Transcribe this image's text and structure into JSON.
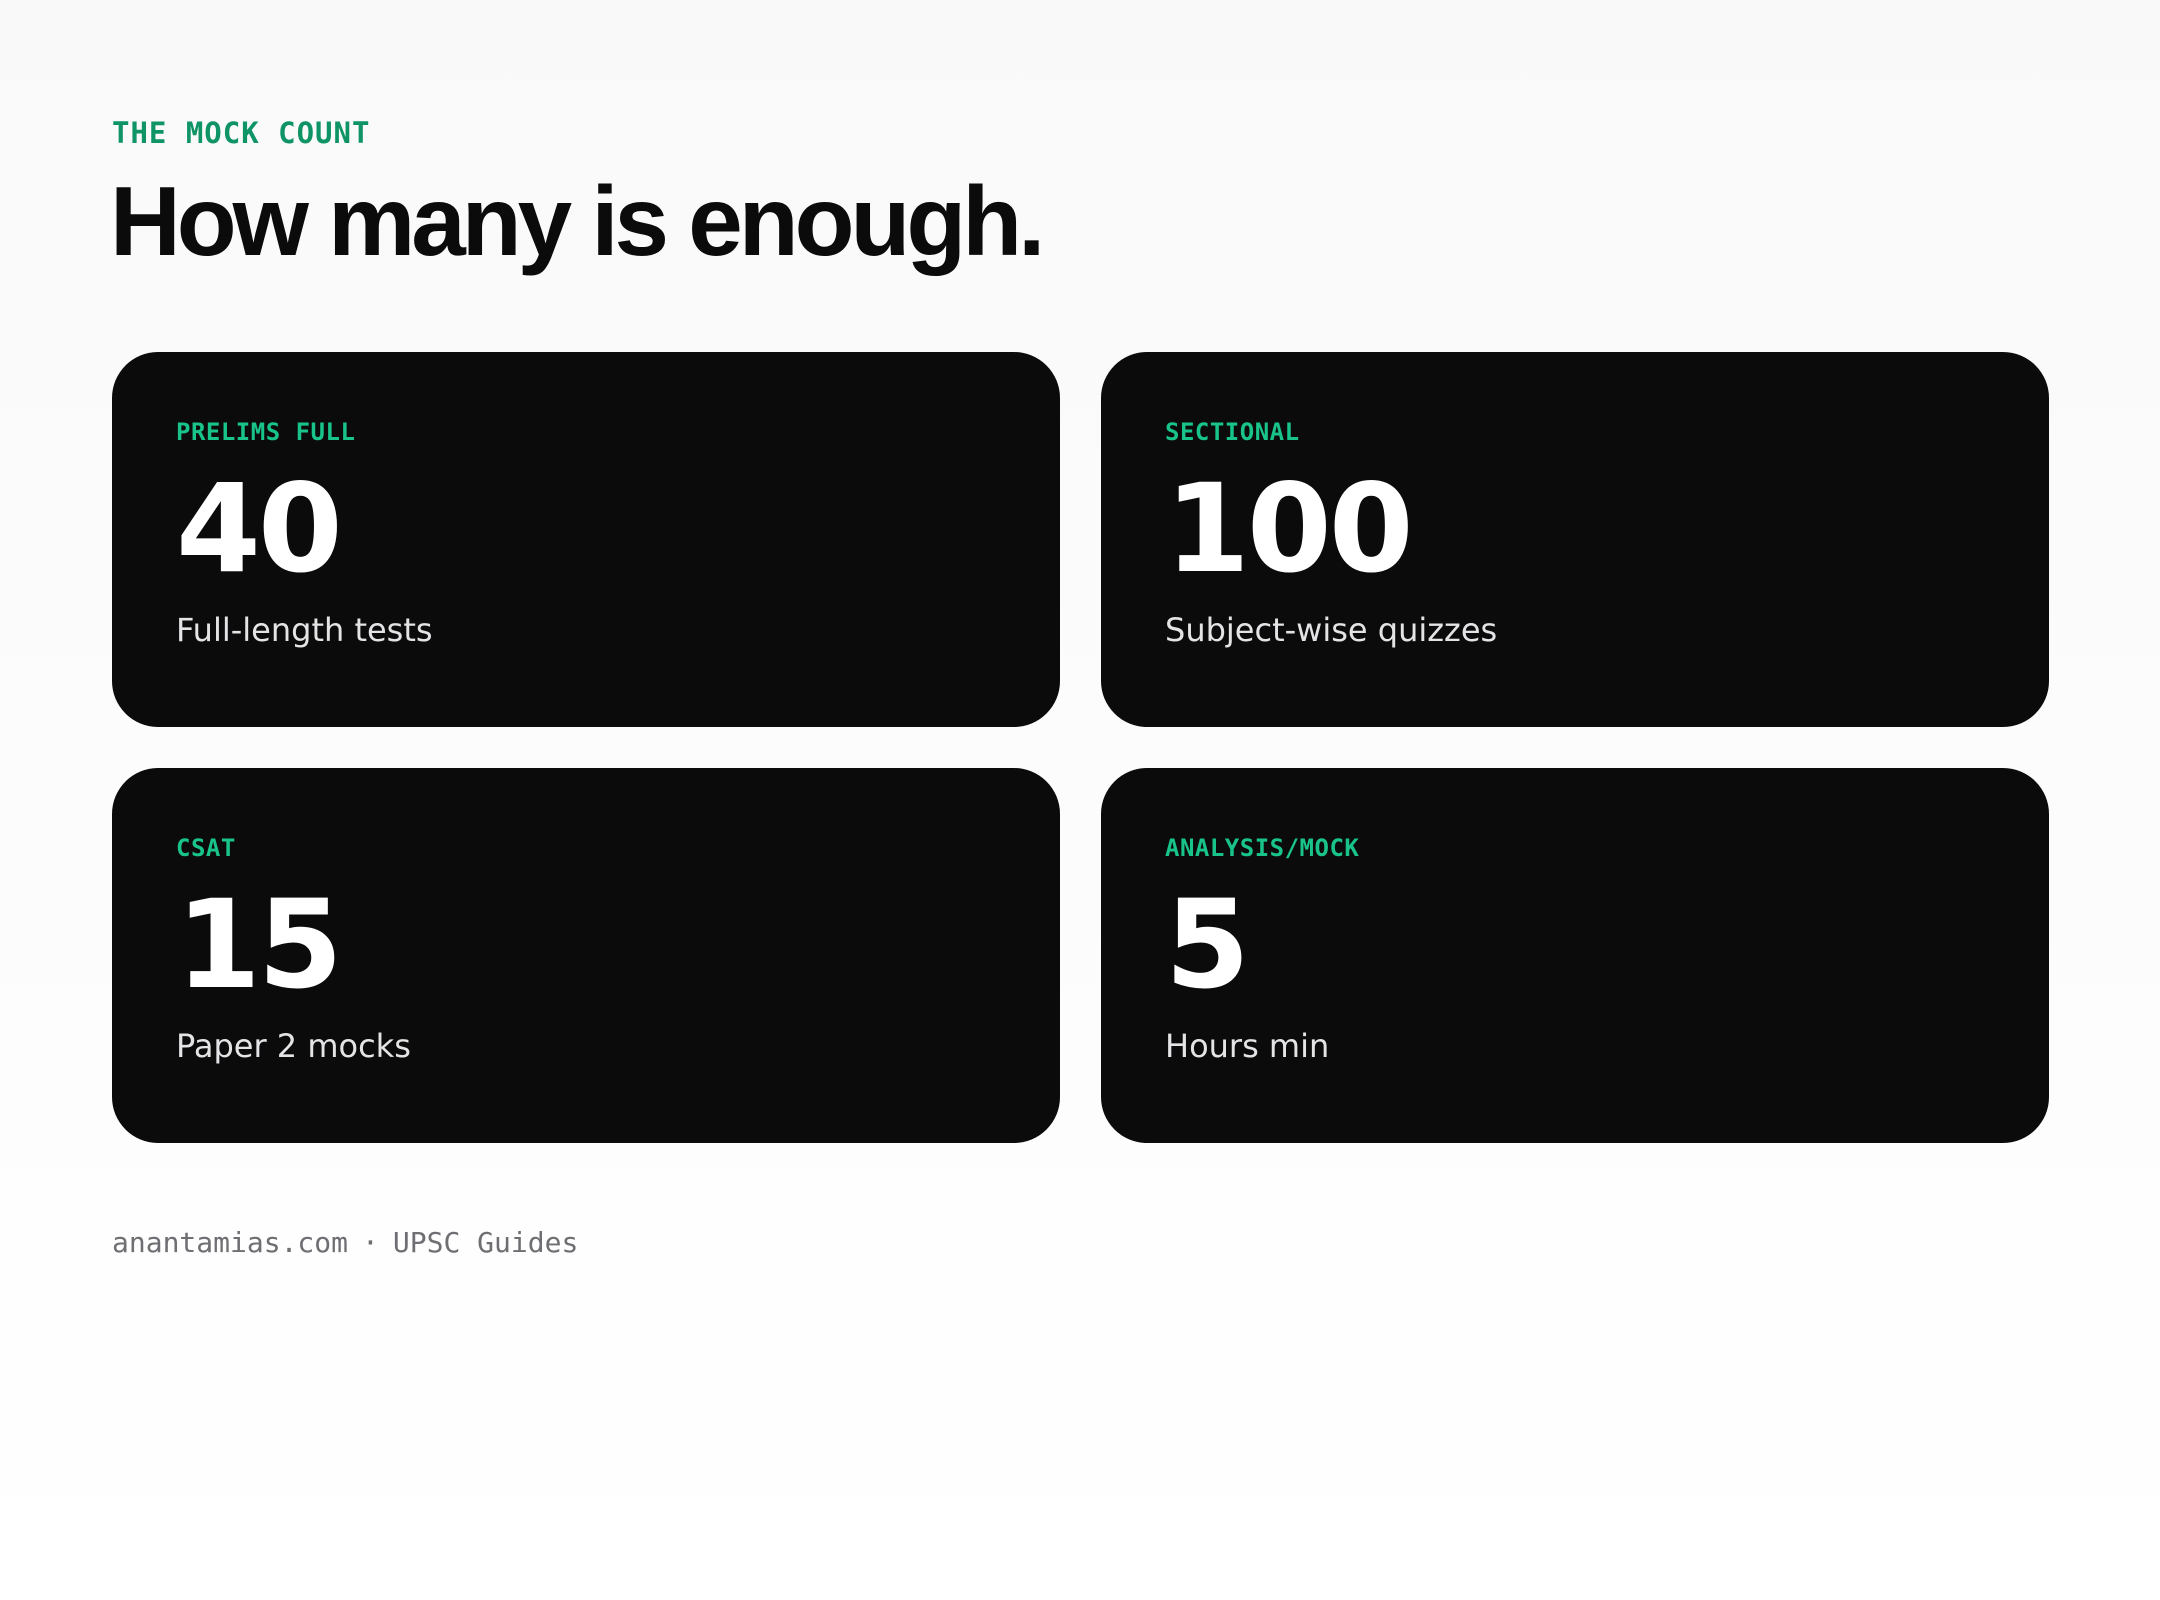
{
  "header": {
    "kicker": "THE MOCK COUNT",
    "title": "How many is enough."
  },
  "cards": [
    {
      "label": "PRELIMS FULL",
      "value": "40",
      "caption": "Full-length tests"
    },
    {
      "label": "SECTIONAL",
      "value": "100",
      "caption": "Subject-wise quizzes"
    },
    {
      "label": "CSAT",
      "value": "15",
      "caption": "Paper 2 mocks"
    },
    {
      "label": "ANALYSIS/MOCK",
      "value": "5",
      "caption": "Hours min"
    }
  ],
  "footer": {
    "site": "anantamias.com",
    "separator": "·",
    "section": "UPSC Guides"
  },
  "colors": {
    "accent": "#0f9466",
    "card_accent": "#19c48a",
    "card_background": "#0b0b0c",
    "page_background": "#f9f9f9"
  }
}
